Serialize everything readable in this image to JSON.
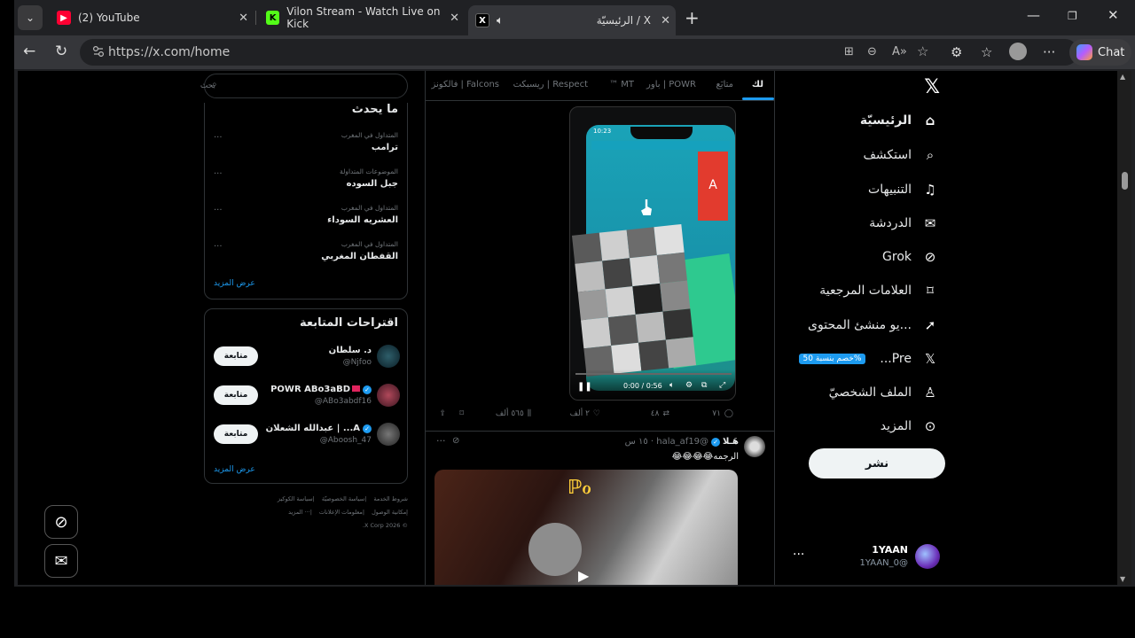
{
  "browser": {
    "tabs": [
      {
        "title": "(2) YouTube",
        "favicon": "youtube-icon"
      },
      {
        "title": "Vilon Stream - Watch Live on Kick",
        "favicon": "kick-icon"
      },
      {
        "title": "الرئيسيّة / X",
        "favicon": "x-icon"
      }
    ],
    "url": "https://x.com/home",
    "chat_label": "Chat"
  },
  "nav": {
    "items": [
      {
        "label": "الرئيسيّة",
        "icon": "home-icon"
      },
      {
        "label": "استكشف",
        "icon": "search-icon"
      },
      {
        "label": "التنبيهات",
        "icon": "bell-icon"
      },
      {
        "label": "الدردشة",
        "icon": "mail-icon"
      },
      {
        "label": "Grok",
        "icon": "grok-icon"
      },
      {
        "label": "العلامات المرجعية",
        "icon": "bookmark-icon"
      },
      {
        "label": "...يو منشئ المحتوى",
        "icon": "rocket-icon"
      },
      {
        "label": "Pre...",
        "icon": "x-premium-icon",
        "badge": "%خصم بنسبة 50"
      },
      {
        "label": "الملف الشخصيّ",
        "icon": "profile-icon"
      },
      {
        "label": "المزيد",
        "icon": "more-icon"
      }
    ],
    "post_label": "نشر",
    "user": {
      "name": "1YAAN",
      "handle": "@1YAAN_0"
    }
  },
  "feed": {
    "tabs": [
      "لك",
      "متابَع",
      "POWR | باور",
      "MT ™",
      "Respect | ريسبكت",
      "Falcons | فالكونز"
    ],
    "post1": {
      "video_time": "0:00 / 0:56",
      "phone_time": "10:23",
      "red_letter": "A",
      "replies": "٧١",
      "reposts": "٤٨",
      "likes": "٢ ألف",
      "views": "٥٦٥ ألف"
    },
    "post2": {
      "name": "هَـلا",
      "handle": "@hala_af19",
      "time": "١٥ س",
      "text": "الرجمه😂😂😂😂"
    }
  },
  "sidebar": {
    "search_placeholder": "بحث",
    "trending_title": "ما يحدث",
    "trends": [
      {
        "meta": "المتداول في المغرب",
        "name": "ترامب"
      },
      {
        "meta": "الموضوعات المتداولة",
        "name": "جبل السوده"
      },
      {
        "meta": "المتداول في المغرب",
        "name": "العشريه السوداء"
      },
      {
        "meta": "المتداول في المغرب",
        "name": "القفطان المغربي"
      }
    ],
    "show_more": "عرض المزيد",
    "suggest_title": "اقتراحات المتابعة",
    "suggestions": [
      {
        "name": "د. سلطان",
        "handle": "@Njfoo",
        "follow": "متابعة"
      },
      {
        "name": "POWR ABo3aBD",
        "handle": "@ABo3abdf16",
        "follow": "متابعة"
      },
      {
        "name": "A... | عبدالله الشعلان",
        "handle": "@Aboosh_47",
        "follow": "متابعة"
      }
    ],
    "footer": [
      "شروط الخدمة",
      "سياسة الخصوصيّة",
      "سياسة الكوكيز",
      "إمكانية الوصول",
      "معلومات الإعلانات",
      "··· المزيد",
      "© 2026 X Corp."
    ]
  },
  "colors": {
    "accent": "#1d9bf0",
    "bg": "#000000",
    "text": "#e7e9ea",
    "muted": "#71767b"
  }
}
